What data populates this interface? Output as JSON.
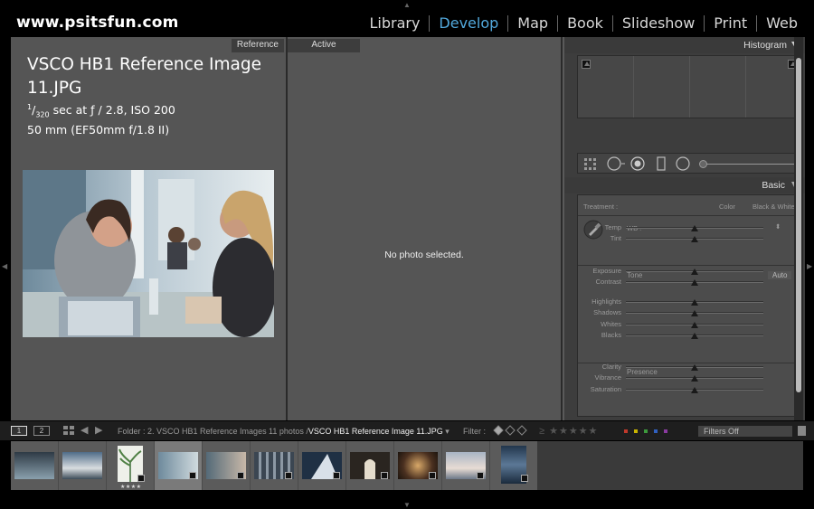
{
  "brand": "www.psitsfun.com",
  "modules": [
    {
      "label": "Library",
      "active": false
    },
    {
      "label": "Develop",
      "active": true
    },
    {
      "label": "Map",
      "active": false
    },
    {
      "label": "Book",
      "active": false
    },
    {
      "label": "Slideshow",
      "active": false
    },
    {
      "label": "Print",
      "active": false
    },
    {
      "label": "Web",
      "active": false
    }
  ],
  "reference_pane": {
    "tab_label": "Reference",
    "title": "VSCO HB1 Reference Image 11.JPG",
    "exposure_numerator": "1",
    "exposure_denominator": "320",
    "exposure_rest": " sec at ƒ / 2.8, ISO 200",
    "lens": "50 mm (EF50mm f/1.8 II)"
  },
  "active_pane": {
    "tab_label": "Active",
    "message": "No photo selected."
  },
  "right_panel": {
    "histogram_label": "Histogram",
    "basic_label": "Basic",
    "treatment_label": "Treatment :",
    "treatment_color": "Color",
    "treatment_bw": "Black & White",
    "wb_label": "WB :",
    "tone_label": "Tone",
    "auto_label": "Auto",
    "presence_label": "Presence",
    "sliders": [
      {
        "label": "Temp",
        "value": 0.5
      },
      {
        "label": "Tint",
        "value": 0.5
      },
      {
        "label": "Exposure",
        "value": 0.5
      },
      {
        "label": "Contrast",
        "value": 0.5
      },
      {
        "label": "Highlights",
        "value": 0.5
      },
      {
        "label": "Shadows",
        "value": 0.5
      },
      {
        "label": "Whites",
        "value": 0.5
      },
      {
        "label": "Blacks",
        "value": 0.5
      },
      {
        "label": "Clarity",
        "value": 0.5
      },
      {
        "label": "Vibrance",
        "value": 0.5
      },
      {
        "label": "Saturation",
        "value": 0.5
      }
    ]
  },
  "filmbar": {
    "view1": "1",
    "view2": "2",
    "folder": "Folder : 2. VSCO HB1 Reference Images",
    "count_prefix": "11 photos /",
    "count_file": "VSCO HB1 Reference Image 11.JPG",
    "filter_label": "Filter :",
    "filters_off": "Filters Off",
    "label_colors": [
      "#c0392b",
      "#c9b400",
      "#3c9a3c",
      "#3060c0",
      "#8a3aa0"
    ]
  },
  "filmstrip": {
    "selected_stars": "★★★★"
  }
}
